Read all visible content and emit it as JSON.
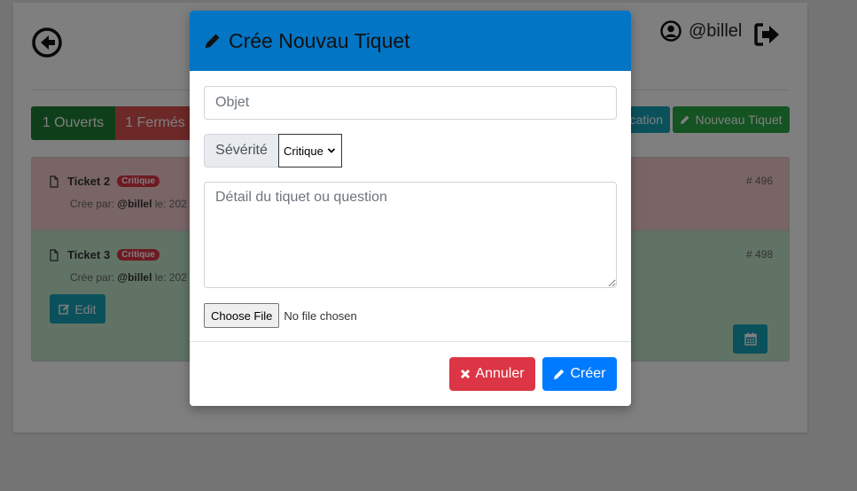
{
  "header": {
    "username": "@billel"
  },
  "tabs": {
    "open_label": "1 Ouverts",
    "closed_label": "1 Fermés"
  },
  "toolbar": {
    "notification_label": "cation",
    "new_ticket_label": "Nouveau Tiquet"
  },
  "tickets": [
    {
      "title": "Ticket 2",
      "severity": "Critique",
      "created_by_prefix": "Crée par:",
      "author": "@billel",
      "date_prefix": "le: 202",
      "number": "# 496",
      "status_color": "#f3caca"
    },
    {
      "title": "Ticket 3",
      "severity": "Critique",
      "created_by_prefix": "Crée par:",
      "author": "@billel",
      "date_prefix": "le: 202",
      "number": "# 498",
      "edit_label": "Edit",
      "status_color": "#c3e6cb"
    }
  ],
  "modal": {
    "title": "Crée Nouvau Tiquet",
    "subject_placeholder": "Objet",
    "severity_label": "Sévérité",
    "severity_value": "Critique",
    "detail_placeholder": "Détail du tiquet ou question",
    "file_button_label": "Choose File",
    "file_status": "No file chosen",
    "cancel_label": "Annuler",
    "create_label": "Créer"
  },
  "colors": {
    "modal_header": "#0275c5",
    "danger": "#dc3545",
    "primary": "#007bff",
    "success": "#28a745",
    "info": "#17a2b8"
  }
}
